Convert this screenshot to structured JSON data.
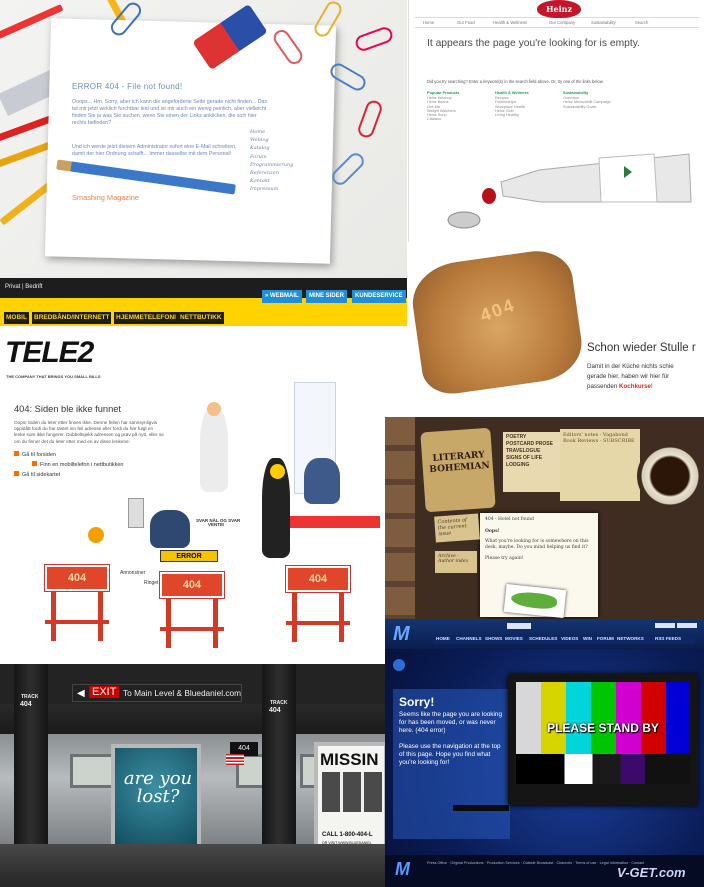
{
  "panel1": {
    "title": "ERROR 404 - File not found!",
    "text1": "Ooops... Hm. Sorry, aber ich kann die angeforderte Seite gerade nicht finden... Das tut mir jetzt wirklich furchtbar leid und ist mir auch ein wenig peinlich, aber vielleicht finden Sie ja was Sie suchen, wenn Sie einen der Links anklicken, die sich hier rechts befinden?",
    "text2": "Und ich werde jetzt diesem Administrator sofort eine E-Mail schreiben, damit der hier Ordnung schafft... Immer dasselbe mit dem Personal!",
    "menu": [
      "Home",
      "Weblog",
      "Katalog",
      "Forum",
      "Programmierung",
      "Referenzen",
      "Kontakt",
      "Impressum"
    ],
    "brand": "Smashing Magazine"
  },
  "panel2": {
    "logo": "Heinz",
    "nav": [
      "Home",
      "Our Food",
      "Health & Wellness",
      "Our Company",
      "Sustainability",
      "Search"
    ],
    "headline": "It appears the page you're looking for is empty.",
    "search_prompt": "Did you try searching? Enter a keyword(s) in the search field above. Or, try one of the links below.",
    "columns": [
      {
        "title": "Popular Products",
        "links": [
          "Heinz Ketchup",
          "Heinz Beans",
          "Ore-Ida",
          "Weight Watchers",
          "Heinz Soup",
          "Classico"
        ]
      },
      {
        "title": "Health & Wellness",
        "links": [
          "Recipes",
          "Partnerships",
          "Workplace Health",
          "Heinz Club",
          "Living Healthy"
        ]
      },
      {
        "title": "Sustainability",
        "links": [
          "Overview",
          "Heinz Microcredit Campaign",
          "Sustainability Goals"
        ]
      }
    ]
  },
  "panel3": {
    "top": "Privat | Bedrift",
    "tabs_yellow": [
      "MOBIL",
      "BREDBÅND/INTERNETT",
      "HJEMMETELEFONI",
      "NETTBUTIKK"
    ],
    "tabs_blue": [
      "» WEBMAIL",
      "MINE SIDER",
      "KUNDESERVICE"
    ],
    "logo": "TELE2",
    "tagline": "THE COMPANY THAT BRINGS YOU SMALL BILLS",
    "heading": "404: Siden ble ikke funnet",
    "para": "Oops! Siden du leter etter finnes ikke. Denne feilen har sannsynligvis oppstått fordi du har tastet inn feil adresse eller fordi du har fulgt en lenke som ikke fungerer. Dobbeltsjekk adressen og prøv på nytt, eller se om du finner det du leter etter med en av disse lenkene:",
    "links": [
      "Gå til forsiden",
      "Finn en mobiltelefon i nettbutikken",
      "Gå til sidekartet"
    ],
    "barriers": [
      "404",
      "404",
      "404"
    ],
    "error_sign": "ERROR",
    "labels": [
      "Annonsiner",
      "Ringet",
      "VENTE!",
      "SVAR NÅL OG SVAR"
    ]
  },
  "panel4": {
    "toast_text": "404",
    "headline": "Schon wieder Stulle r",
    "sub1": "Damit in der Küche nichts schie",
    "sub2": "gerade hier, haben wir hier für",
    "sub3a": "passenden ",
    "sub3b": "Kochkurse",
    "sub3c": "!"
  },
  "panel5": {
    "logo_line1": "LITERARY",
    "logo_line2": "BOHEMIAN",
    "menu": [
      "POETRY",
      "POSTCARD PROSE",
      "TRAVELOGUE",
      "SIGNS OF LIFE",
      "LODGING"
    ],
    "notes": "Editors' notes · Vagabond Book Reviews · SUBSCRIBE",
    "contents": "Contents of the current issue",
    "archive": "Archive · Author index",
    "page_title": "404 - Hotel not found",
    "oops": "Oops!",
    "msg": "What you're looking for is somewhere on this desk, maybe. Do you mind helping us find it?",
    "thanks": "Please try again!"
  },
  "panel6": {
    "exit": "EXIT",
    "direction": "To Main Level & Bluedaniel.com",
    "track": "TRACK",
    "track_num": "404",
    "poster1": "are you lost?",
    "poster2_title": "MISSIN",
    "poster2_call": "CALL 1-800-404-L",
    "poster2_url": "OR VISIT WWW.BLUEDANIEL"
  },
  "panel7": {
    "nav": [
      "HOME",
      "CHANNELS",
      "SHOWS",
      "MOVIES",
      "SCHEDULES",
      "VIDEOS",
      "WIN",
      "FORUM",
      "NETWORKS",
      "RSS FEEDS"
    ],
    "sorry": "Sorry!",
    "text1": "Seems like the page you are looking for has been moved, or was never here. (404 error)",
    "text2": "Please use the navigation at the top of this page. Hope you find what you're looking for!",
    "tv_text": "PLEASE STAND BY",
    "footer": "Press Office · Original Productions · Production Services · Outside Broadcast · Channels · Terms of use · Legal Information · Contact",
    "watermark": "V-GET.com",
    "colors": {
      "bars": [
        "#d7d7d7",
        "#d8d400",
        "#00d6d9",
        "#00c600",
        "#d000d0",
        "#d00000",
        "#0000d6"
      ]
    }
  }
}
